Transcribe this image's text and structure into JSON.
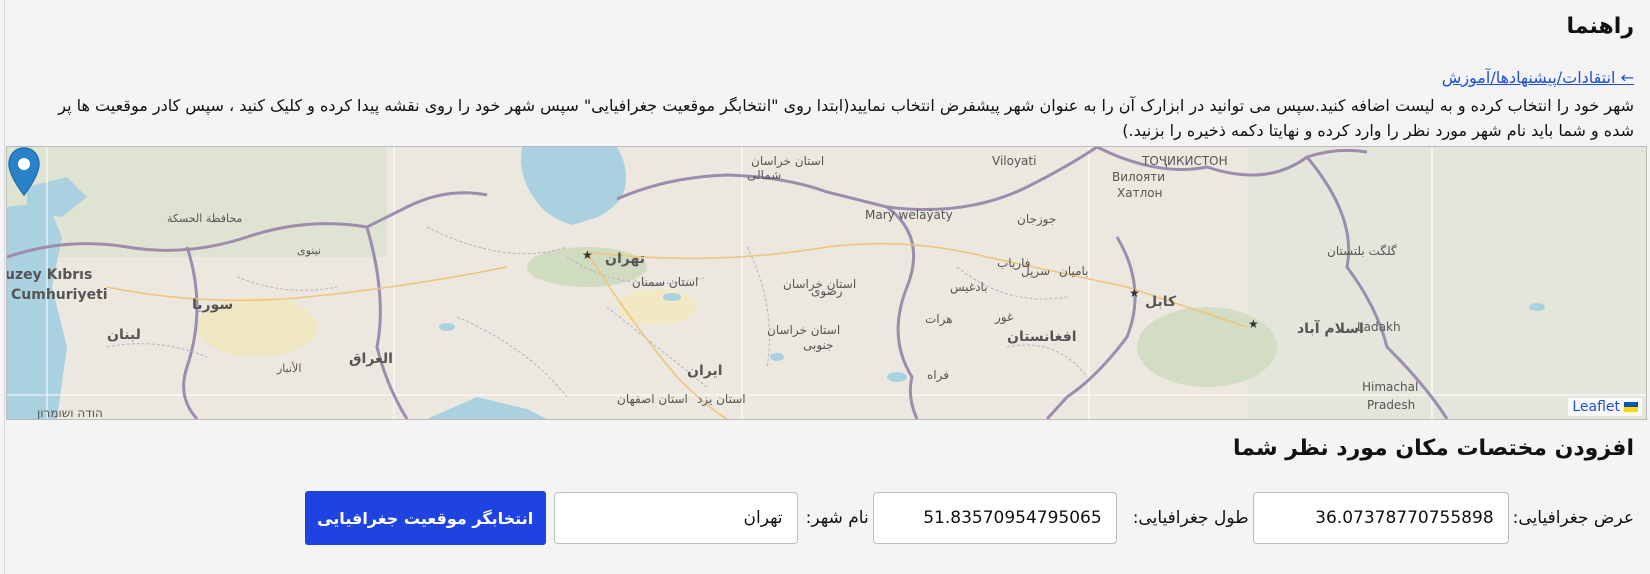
{
  "guide": {
    "heading": "راهنما",
    "feedback_link": "← انتقادات/پیشنهادها/آموزش",
    "instructions": "شهر خود را انتخاب کرده و به لیست اضافه کنید.سپس می توانید در ابزارک آن را به عنوان شهر پیشفرض انتخاب نمایید(ابتدا روی \"انتخابگر موقعیت جغرافیایی\" سپس شهر خود را روی نقشه پیدا کرده و کلیک کنید ، سپس کادر موقعیت ها پر شده و شما باید نام شهر مورد نظر را وارد کرده و نهایتا دکمه ذخیره را بزنید.)"
  },
  "map": {
    "attribution": "Leaflet",
    "labels": [
      {
        "text": "Viloyati",
        "size": 12
      },
      {
        "text": "ТОҶИКИСТОН",
        "size": 12
      },
      {
        "text": "Вилояти",
        "size": 12
      },
      {
        "text": "Хатлон",
        "size": 12
      },
      {
        "text": "Mary welaýaty",
        "size": 12
      },
      {
        "text": "تهران",
        "size": 14
      },
      {
        "text": "استان خراسان",
        "size": 12
      },
      {
        "text": "شمالی",
        "size": 12
      },
      {
        "text": "استان خراسان",
        "size": 12
      },
      {
        "text": "رضوی",
        "size": 12
      },
      {
        "text": "استان سمنان",
        "size": 12
      },
      {
        "text": "استان خراسان",
        "size": 12
      },
      {
        "text": "جنوبی",
        "size": 12
      },
      {
        "text": "ایران",
        "size": 14
      },
      {
        "text": "استان اصفهان",
        "size": 12
      },
      {
        "text": "استان یزد",
        "size": 12
      },
      {
        "text": "کابل",
        "size": 14
      },
      {
        "text": "افغانستان",
        "size": 14
      },
      {
        "text": "اسلام آباد",
        "size": 14
      },
      {
        "text": "گلگت بلتستان",
        "size": 12
      },
      {
        "text": "Ladakh",
        "size": 12
      },
      {
        "text": "Himachal",
        "size": 12
      },
      {
        "text": "Pradesh",
        "size": 12
      },
      {
        "text": "uzey Kıbrıs",
        "size": 14
      },
      {
        "text": "Cumhuriyeti",
        "size": 14
      },
      {
        "text": "سوریا",
        "size": 14
      },
      {
        "text": "لبنان",
        "size": 14
      },
      {
        "text": "العراق",
        "size": 14
      },
      {
        "text": "הודה ושומרון",
        "size": 12
      },
      {
        "text": "محافظة الحسكة",
        "size": 11
      },
      {
        "text": "نينوى",
        "size": 11
      },
      {
        "text": "الأنبار",
        "size": 11
      },
      {
        "text": "هرات",
        "size": 12
      },
      {
        "text": "فراه",
        "size": 12
      },
      {
        "text": "بادغيس",
        "size": 12
      },
      {
        "text": "غور",
        "size": 12
      },
      {
        "text": "بامیان",
        "size": 12
      },
      {
        "text": "جوزجان",
        "size": 12
      },
      {
        "text": "سرپل",
        "size": 12
      },
      {
        "text": "فاریاب",
        "size": 12
      }
    ]
  },
  "form": {
    "title": "افزودن مختصات مکان مورد نظر شما",
    "latitude_label": "عرض جغرافیایی:",
    "latitude_value": "36.07378770755898",
    "longitude_label": "طول جغرافیایی:",
    "longitude_value": "51.83570954795065",
    "city_label": "نام شهر:",
    "city_value": "تهران",
    "geo_button": "انتخابگر موقعیت جغرافیایی"
  }
}
